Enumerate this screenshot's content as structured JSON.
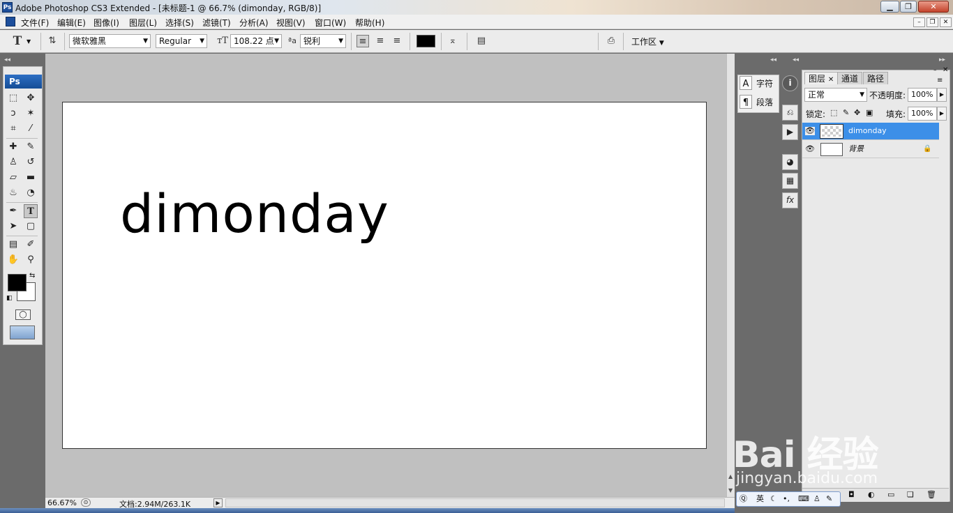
{
  "window": {
    "app_icon_label": "Ps",
    "title": "Adobe Photoshop CS3 Extended - [未标题-1 @ 66.7% (dimonday, RGB/8)]",
    "minimize": "▁",
    "restore": "❐",
    "close": "✕"
  },
  "menubar": {
    "items": [
      "文件(F)",
      "编辑(E)",
      "图像(I)",
      "图层(L)",
      "选择(S)",
      "滤镜(T)",
      "分析(A)",
      "视图(V)",
      "窗口(W)",
      "帮助(H)"
    ],
    "doc_minimize": "–",
    "doc_restore": "❐",
    "doc_close": "✕"
  },
  "options": {
    "tool_glyph": "T",
    "font_family": "微软雅黑",
    "font_style": "Regular",
    "font_size": "108.22 点",
    "aa_label": "ªa",
    "antialias": "锐利",
    "color_swatch": "#000000",
    "workspace": "工作区"
  },
  "toolbox": {
    "badge": "Ps",
    "tools": [
      {
        "name": "marquee-tool",
        "glyph": "⬚"
      },
      {
        "name": "move-tool",
        "glyph": "✥"
      },
      {
        "name": "lasso-tool",
        "glyph": "ↄ"
      },
      {
        "name": "magic-wand-tool",
        "glyph": "✶"
      },
      {
        "name": "crop-tool",
        "glyph": "⌗"
      },
      {
        "name": "slice-tool",
        "glyph": "⁄"
      },
      {
        "name": "healing-tool",
        "glyph": "✚"
      },
      {
        "name": "brush-tool",
        "glyph": "✎"
      },
      {
        "name": "stamp-tool",
        "glyph": "♙"
      },
      {
        "name": "history-brush-tool",
        "glyph": "↺"
      },
      {
        "name": "eraser-tool",
        "glyph": "▱"
      },
      {
        "name": "gradient-tool",
        "glyph": "▬"
      },
      {
        "name": "blur-tool",
        "glyph": "♨"
      },
      {
        "name": "dodge-tool",
        "glyph": "◔"
      },
      {
        "name": "pen-tool",
        "glyph": "✒"
      },
      {
        "name": "type-tool",
        "glyph": "T"
      },
      {
        "name": "path-select-tool",
        "glyph": "➤"
      },
      {
        "name": "shape-tool",
        "glyph": "▢"
      },
      {
        "name": "notes-tool",
        "glyph": "▤"
      },
      {
        "name": "eyedropper-tool",
        "glyph": "✐"
      },
      {
        "name": "hand-tool",
        "glyph": "✋"
      },
      {
        "name": "zoom-tool",
        "glyph": "⚲"
      }
    ],
    "foreground_color": "#000000",
    "background_color": "#ffffff"
  },
  "canvas": {
    "text": "dimonday"
  },
  "statusbar": {
    "zoom": "66.67%",
    "doc_info": "文档:2.94M/263.1K"
  },
  "char_panel": {
    "character": "字符",
    "paragraph": "段落",
    "char_icon": "A",
    "para_icon": "¶"
  },
  "layers_panel": {
    "tabs": [
      "图层",
      "通道",
      "路径"
    ],
    "blend_mode": "正常",
    "opacity_label": "不透明度:",
    "opacity": "100%",
    "lock_label": "锁定:",
    "fill_label": "填充:",
    "fill": "100%",
    "layers": [
      {
        "name": "dimonday",
        "selected": true
      },
      {
        "name": "背景",
        "selected": false,
        "locked": true
      }
    ]
  },
  "ime": {
    "lang": "英"
  },
  "watermark": {
    "brand": "Bai 经验",
    "url": "jingyan.baidu.com"
  }
}
